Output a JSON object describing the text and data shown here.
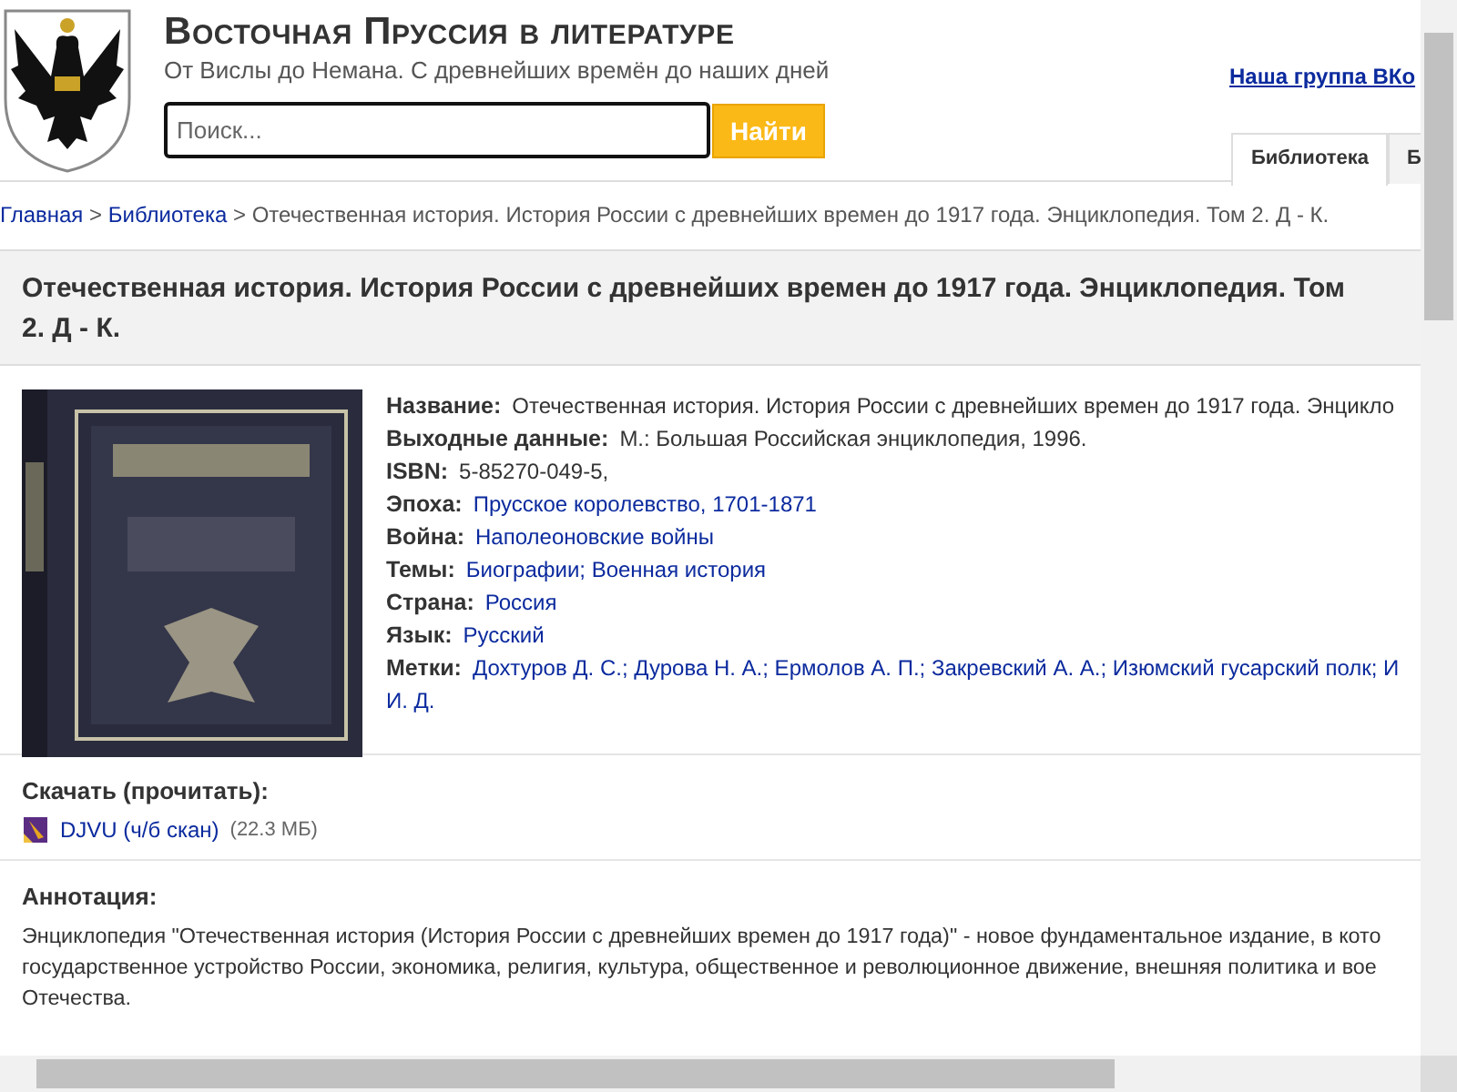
{
  "header": {
    "title": "Восточная Пруссия в литературе",
    "subtitle": "От Вислы до Немана. С древнейших времён до наших дней",
    "search": {
      "placeholder": "Поиск..."
    },
    "search_button": "Найти",
    "group_link": "Наша группа ВКо",
    "tabs": [
      {
        "label": "Библиотека",
        "selected": true
      },
      {
        "label": "Б",
        "selected": false
      }
    ]
  },
  "breadcrumb": {
    "separator": ">",
    "items": [
      "Главная",
      "Библиотека",
      "Отечественная история. История России с древнейших времен до 1917 года. Энциклопедия. Том 2. Д - К."
    ]
  },
  "book": {
    "heading": "Отечественная история. История России с древнейших времен до 1917 года. Энциклопедия. Том 2. Д - К.",
    "fields": [
      {
        "label": "Название:",
        "kind": "text",
        "lines": [
          "Отечественная история. История России с древнейших времен до 1917 года. Энцикло"
        ]
      },
      {
        "label": "Выходные данные:",
        "kind": "text",
        "lines": [
          "М.: Большая Российская энциклопедия, 1996."
        ]
      },
      {
        "label": "ISBN:",
        "kind": "text",
        "lines": [
          "5-85270-049-5,"
        ]
      },
      {
        "label": "Эпоха:",
        "kind": "link",
        "lines": [
          "Прусское королевство, 1701-1871"
        ]
      },
      {
        "label": "Война:",
        "kind": "link",
        "lines": [
          "Наполеоновские войны"
        ]
      },
      {
        "label": "Темы:",
        "kind": "link",
        "lines": [
          "Биографии; Военная история"
        ]
      },
      {
        "label": "Страна:",
        "kind": "link",
        "lines": [
          "Россия"
        ]
      },
      {
        "label": "Язык:",
        "kind": "link",
        "lines": [
          "Русский"
        ]
      },
      {
        "label": "Метки:",
        "kind": "link",
        "lines": [
          "Дохтуров Д. С.; Дурова Н. А.; Ермолов А. П.; Закревский А. А.; Изюмский гусарский полк; И",
          "И. Д."
        ]
      }
    ]
  },
  "download": {
    "heading": "Скачать (прочитать):",
    "files": [
      {
        "name": "DJVU (ч/б скан)",
        "size": "(22.3 МБ)"
      }
    ]
  },
  "annotation": {
    "heading": "Аннотация:",
    "lines": [
      "Энциклопедия \"Отечественная история (История России с древнейших времен до 1917 года)\" - новое фундаментальное издание, в кото",
      "государственное устройство России, экономика, религия, культура, общественное и революционное движение, внешняя политика и вое",
      "Отечества."
    ]
  }
}
